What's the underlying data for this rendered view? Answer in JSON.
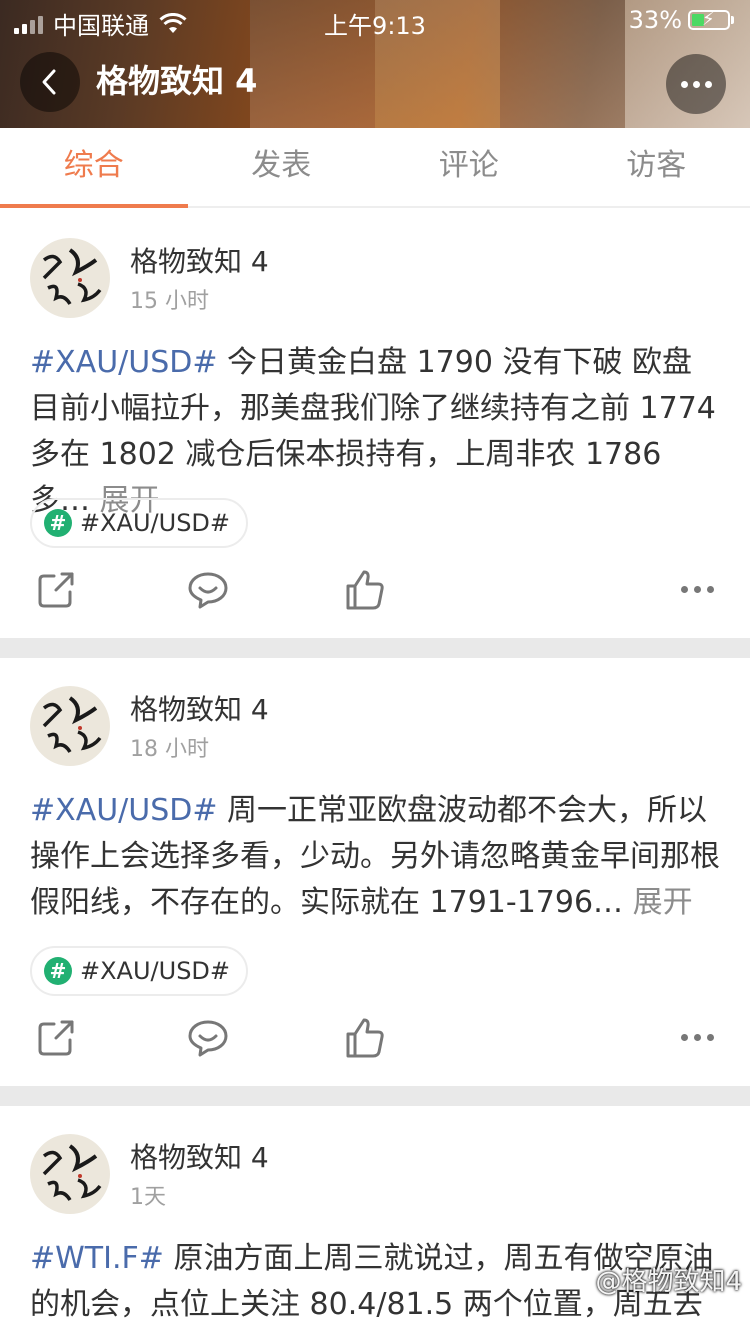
{
  "status_bar": {
    "carrier": "中国联通",
    "time": "上午9:13",
    "battery": "33%"
  },
  "header": {
    "title": "格物致知 4"
  },
  "tabs": [
    {
      "label": "综合",
      "active": true
    },
    {
      "label": "发表",
      "active": false
    },
    {
      "label": "评论",
      "active": false
    },
    {
      "label": "访客",
      "active": false
    }
  ],
  "posts": [
    {
      "username": "格物致知 4",
      "time": "15 小时",
      "tag": "#XAU/USD#",
      "body": " 今日黄金白盘 1790 没有下破 欧盘目前小幅拉升，那美盘我们除了继续持有之前 1774 多在 1802 减仓后保本损持有，上周非农 1786 多…",
      "expand": " 展开",
      "topic": "#XAU/USD#"
    },
    {
      "username": "格物致知 4",
      "time": "18 小时",
      "tag": "#XAU/USD#",
      "body": " 周一正常亚欧盘波动都不会大，所以操作上会选择多看，少动。另外请忽略黄金早间那根假阳线，不存在的。实际就在 1791-1796…",
      "expand": " 展开",
      "topic": "#XAU/USD#"
    },
    {
      "username": "格物致知 4",
      "time": "1天",
      "tag": "#WTI.F#",
      "body": " 原油方面上周三就说过，周五有做空原油的机会，点位上关注 80.4/81.5 两个位置，周五去做",
      "expand": "",
      "topic": ""
    }
  ],
  "watermark": "@格物致知4",
  "icons": {
    "share": "share-icon",
    "comment": "comment-icon",
    "like": "thumbs-up-icon",
    "more": "more-icon"
  },
  "colors": {
    "accent": "#ef7b4d",
    "hashtag": "#4a6bab",
    "topic_icon": "#21b072"
  }
}
